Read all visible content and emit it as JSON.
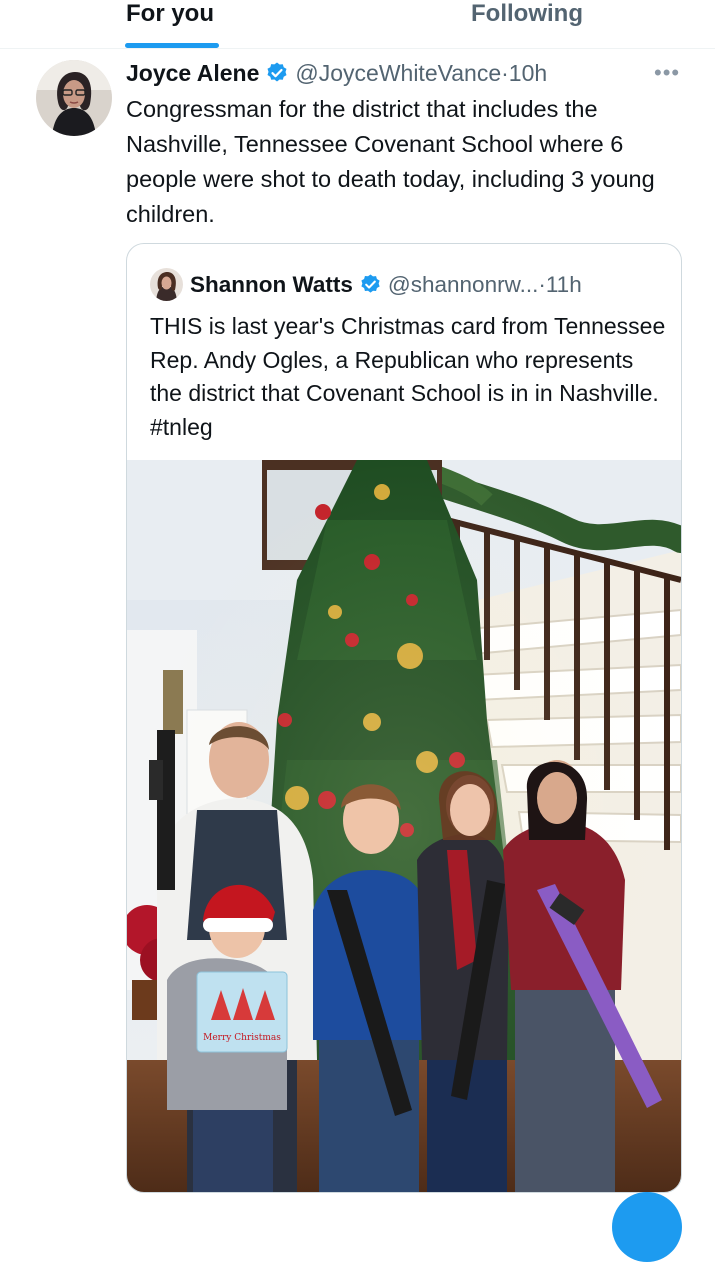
{
  "tabs": {
    "for_you": "For you",
    "following": "Following"
  },
  "tweet": {
    "name": "Joyce Alene",
    "handle": "@JoyceWhiteVance",
    "separator": "·",
    "time": "10h",
    "more": "•••",
    "text": "Congressman for the district that includes the Nashville, Tennessee Covenant School where 6 people were shot to death today, including 3 young children."
  },
  "quote": {
    "name": "Shannon Watts",
    "handle": "@shannonrw...",
    "separator": "·",
    "time": "11h",
    "text": "THIS is last year's Christmas card from Tennessee Rep. Andy Ogles, a Republican who represents the district that Covenant School is in in Nashville. #tnleg",
    "card_text": "Merry Christmas"
  },
  "icons": {
    "verified": "verified-badge-icon",
    "more": "more-options-icon"
  },
  "colors": {
    "accent": "#1d9bf0",
    "text_primary": "#0f1419",
    "text_secondary": "#536471",
    "border": "#cfd9de"
  }
}
